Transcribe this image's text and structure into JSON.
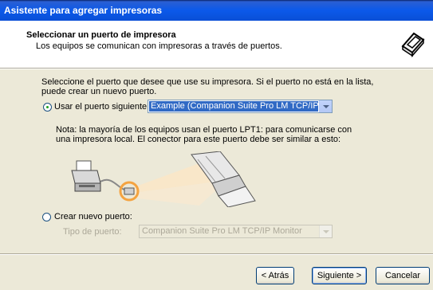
{
  "window": {
    "title": "Asistente para agregar impresoras"
  },
  "header": {
    "title": "Seleccionar un puerto de impresora",
    "subtitle": "Los equipos se comunican con impresoras a través de puertos.",
    "icon": "printer-wizard-icon"
  },
  "intro": {
    "line1": "Seleccione el puerto que desee que use su impresora. Si el puerto no está en la lista,",
    "line2": "puede crear un nuevo puerto."
  },
  "use_existing": {
    "label": "Usar el puerto siguiente:",
    "selected": true,
    "port_value": "Example (Companion Suite Pro LM TCP/IP Monitor)"
  },
  "note": {
    "line1": "Nota: la mayoría de los equipos usan el puerto LPT1: para comunicarse con",
    "line2": "una impresora local. El conector para este puerto debe ser similar a esto:"
  },
  "create_new": {
    "label": "Crear nuevo puerto:",
    "selected": false,
    "type_label": "Tipo de puerto:",
    "type_value": "Companion Suite Pro LM TCP/IP Monitor"
  },
  "buttons": {
    "back": "< Atrás",
    "next": "Siguiente >",
    "cancel": "Cancelar"
  }
}
